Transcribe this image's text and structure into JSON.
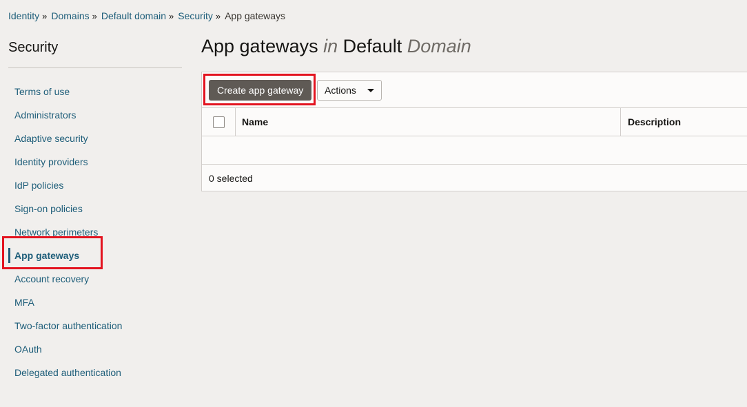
{
  "breadcrumb": {
    "items": [
      "Identity",
      "Domains",
      "Default domain",
      "Security"
    ],
    "current": "App gateways",
    "separator": "»"
  },
  "sidebar": {
    "title": "Security",
    "items": [
      {
        "label": "Terms of use"
      },
      {
        "label": "Administrators"
      },
      {
        "label": "Adaptive security"
      },
      {
        "label": "Identity providers"
      },
      {
        "label": "IdP policies"
      },
      {
        "label": "Sign-on policies"
      },
      {
        "label": "Network perimeters"
      },
      {
        "label": "App gateways",
        "active": true
      },
      {
        "label": "Account recovery"
      },
      {
        "label": "MFA"
      },
      {
        "label": "Two-factor authentication"
      },
      {
        "label": "OAuth"
      },
      {
        "label": "Delegated authentication"
      }
    ]
  },
  "page": {
    "title_main": "App gateways",
    "title_in": "in",
    "title_domain_name": "Default",
    "title_domain_word": "Domain"
  },
  "toolbar": {
    "create_label": "Create app gateway",
    "actions_label": "Actions"
  },
  "table": {
    "columns": [
      "Name",
      "Description"
    ],
    "rows": [],
    "footer": "0 selected"
  },
  "colors": {
    "link": "#1d5d79",
    "primary_button": "#5f5a55",
    "highlight": "#e3131f",
    "background": "#f1efed"
  }
}
